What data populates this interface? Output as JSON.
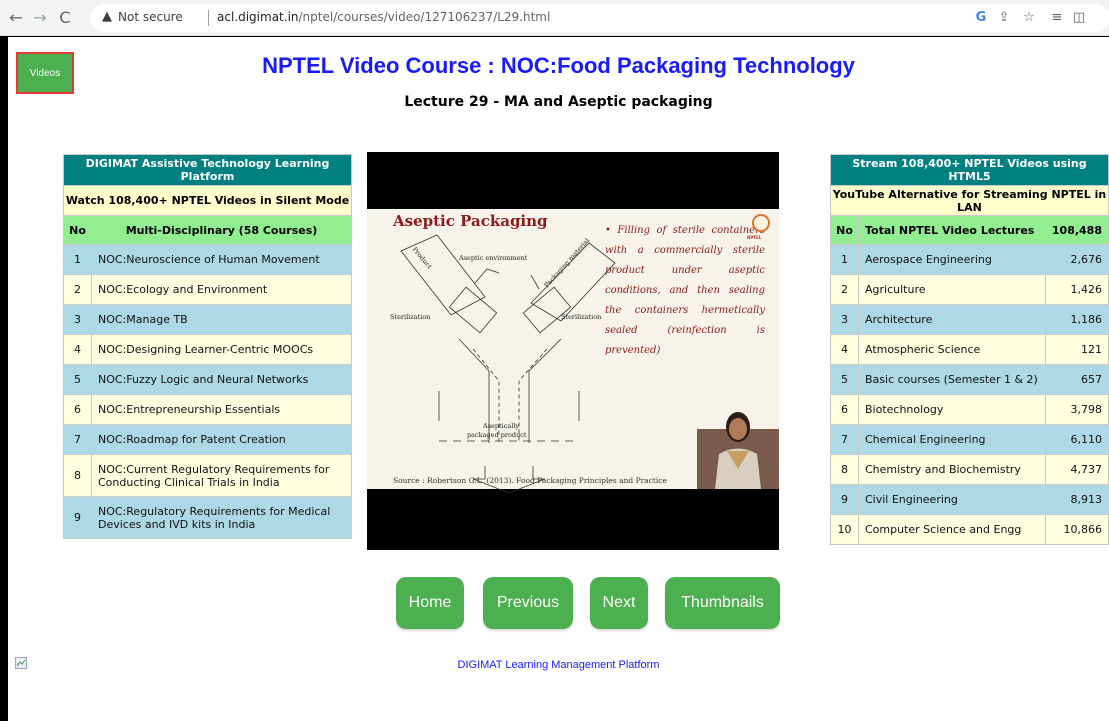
{
  "browser": {
    "back_icon": "←",
    "forward_icon": "→",
    "reload_icon": "C",
    "security_label": "Not secure",
    "url_host": "acl.digimat.in",
    "url_path": "/nptel/courses/video/127106237/L29.html"
  },
  "page": {
    "videos_button": "Videos",
    "title": "NPTEL Video Course : NOC:Food Packaging Technology",
    "subtitle": "Lecture 29 - MA and Aseptic packaging"
  },
  "left_table": {
    "header1": "DIGIMAT Assistive Technology Learning Platform",
    "header2": "Watch 108,400+ NPTEL Videos in Silent Mode",
    "col_no": "No",
    "col_title": "Multi-Disciplinary (58 Courses)",
    "rows": [
      {
        "no": "1",
        "name": "NOC:Neuroscience of Human Movement"
      },
      {
        "no": "2",
        "name": "NOC:Ecology and Environment"
      },
      {
        "no": "3",
        "name": "NOC:Manage TB"
      },
      {
        "no": "4",
        "name": "NOC:Designing Learner-Centric MOOCs"
      },
      {
        "no": "5",
        "name": "NOC:Fuzzy Logic and Neural Networks"
      },
      {
        "no": "6",
        "name": "NOC:Entrepreneurship Essentials"
      },
      {
        "no": "7",
        "name": "NOC:Roadmap for Patent Creation"
      },
      {
        "no": "8",
        "name": "NOC:Current Regulatory Requirements for Conducting Clinical Trials in India"
      },
      {
        "no": "9",
        "name": "NOC:Regulatory Requirements for Medical Devices and IVD kits in India"
      }
    ]
  },
  "right_table": {
    "header1": "Stream 108,400+ NPTEL Videos using HTML5",
    "header2": "YouTube Alternative for Streaming NPTEL in LAN",
    "col_no": "No",
    "col_title": "Total NPTEL Video Lectures",
    "col_total": "108,488",
    "rows": [
      {
        "no": "1",
        "name": "Aerospace Engineering",
        "count": "2,676"
      },
      {
        "no": "2",
        "name": "Agriculture",
        "count": "1,426"
      },
      {
        "no": "3",
        "name": "Architecture",
        "count": "1,186"
      },
      {
        "no": "4",
        "name": "Atmospheric Science",
        "count": "121"
      },
      {
        "no": "5",
        "name": "Basic courses (Semester 1 & 2)",
        "count": "657"
      },
      {
        "no": "6",
        "name": "Biotechnology",
        "count": "3,798"
      },
      {
        "no": "7",
        "name": "Chemical Engineering",
        "count": "6,110"
      },
      {
        "no": "8",
        "name": "Chemistry and Biochemistry",
        "count": "4,737"
      },
      {
        "no": "9",
        "name": "Civil Engineering",
        "count": "8,913"
      },
      {
        "no": "10",
        "name": "Computer Science and Engg",
        "count": "10,866"
      }
    ]
  },
  "slide": {
    "title": "Aseptic Packaging",
    "bullet": "• Filling of sterile containers with a commercially sterile product under aseptic conditions, and then sealing the containers hermetically sealed (reinfection is prevented)",
    "label_product": "Product",
    "label_packaging": "Packaging material",
    "label_environment": "Aseptic environment",
    "label_sterilization_left": "Sterilization",
    "label_sterilization_right": "Sterilization",
    "label_packaged_1": "Aseptically",
    "label_packaged_2": "packaged product",
    "source": "Source : Robertson G.L. (2013). Food Packaging Principles and Practice",
    "logo_text": "NPTEL"
  },
  "nav": {
    "home": "Home",
    "previous": "Previous",
    "next": "Next",
    "thumbnails": "Thumbnails"
  },
  "footer": {
    "link": "DIGIMAT Learning Management Platform"
  },
  "colors": {
    "title_blue": "#1a1aff",
    "button_green": "#4caf50",
    "teal_header": "#008080",
    "row_blue": "#add8e6",
    "row_yellow": "#ffffe0",
    "slide_red": "#8b1a1a"
  }
}
